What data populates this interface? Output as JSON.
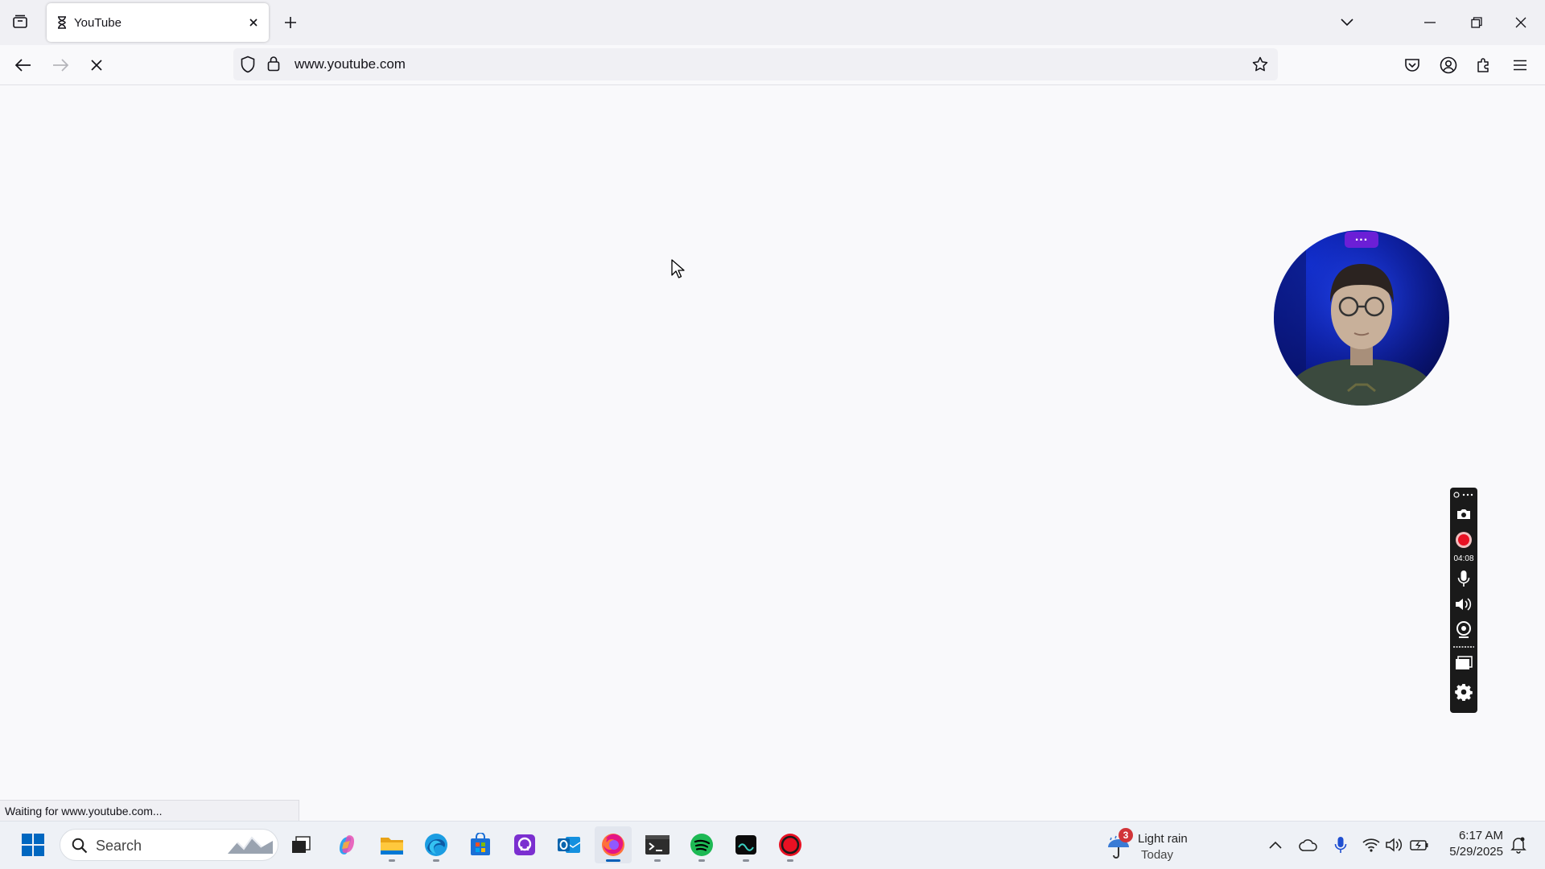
{
  "browser": {
    "tab": {
      "title": "YouTube"
    },
    "url": "www.youtube.com",
    "status_text": "Waiting for www.youtube.com..."
  },
  "recorder": {
    "timer": "04:08"
  },
  "taskbar": {
    "search_label": "Search",
    "apps": [
      "start-icon",
      "task-view-icon",
      "copilot-icon",
      "file-explorer-icon",
      "edge-icon",
      "microsoft-store-icon",
      "app-icon",
      "outlook-icon",
      "firefox-icon",
      "terminal-icon",
      "spotify-icon",
      "app-icon",
      "recorder-icon"
    ],
    "weather": {
      "badge": "3",
      "title": "Light rain",
      "subtitle": "Today"
    },
    "clock": {
      "time": "6:17 AM",
      "date": "5/29/2025"
    }
  },
  "colors": {
    "accent": "#005fb8",
    "webcam_menu": "#6b1fd6",
    "record_red": "#e81123",
    "spotify_green": "#1db954"
  }
}
